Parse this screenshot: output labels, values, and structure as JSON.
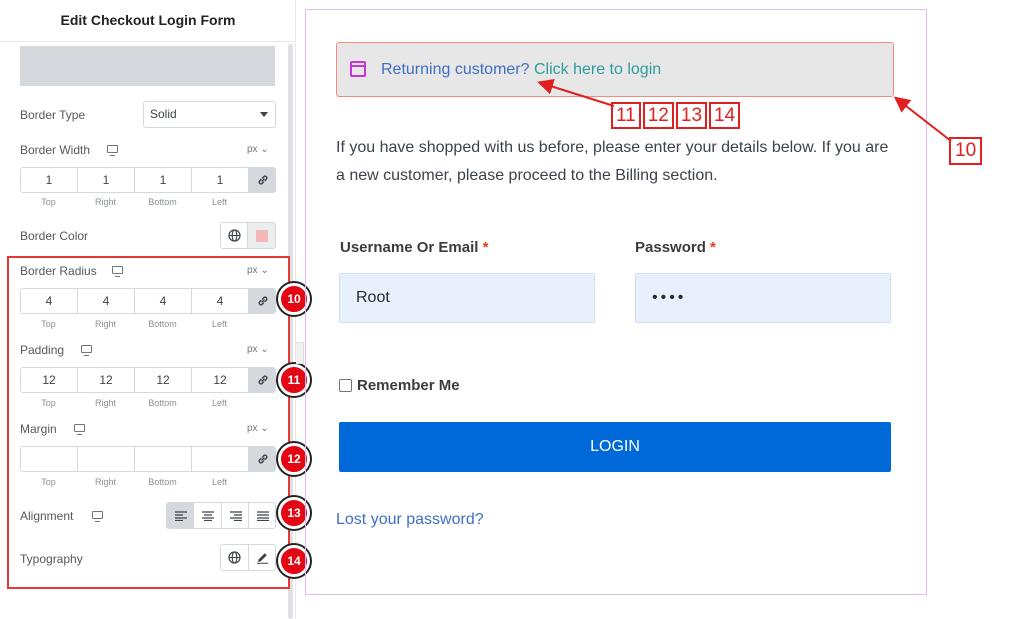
{
  "panel": {
    "title": "Edit Checkout Login Form",
    "border_type": {
      "label": "Border Type",
      "value": "Solid"
    },
    "border_width": {
      "label": "Border Width",
      "unit": "px ⌄",
      "values": [
        "1",
        "1",
        "1",
        "1"
      ]
    },
    "border_color": {
      "label": "Border Color",
      "color": "#f4b8b8"
    },
    "border_radius": {
      "label": "Border Radius",
      "unit": "px ⌄",
      "values": [
        "4",
        "4",
        "4",
        "4"
      ]
    },
    "padding": {
      "label": "Padding",
      "unit": "px ⌄",
      "values": [
        "12",
        "12",
        "12",
        "12"
      ]
    },
    "margin": {
      "label": "Margin",
      "unit": "px ⌄",
      "values": [
        "",
        "",
        "",
        ""
      ]
    },
    "side_labels": [
      "Top",
      "Right",
      "Bottom",
      "Left"
    ],
    "alignment": {
      "label": "Alignment",
      "options": [
        "align-left-icon",
        "align-center-icon",
        "align-right-icon",
        "align-justify-icon"
      ],
      "active": "align-left-icon"
    },
    "typography": {
      "label": "Typography"
    },
    "markers": [
      "10",
      "11",
      "12",
      "13",
      "14"
    ]
  },
  "preview": {
    "notice": {
      "text": "Returning customer?",
      "link": "Click here to login"
    },
    "annotations": [
      "11",
      "12",
      "13",
      "14"
    ],
    "annotation_10": "10",
    "intro": "If you have shopped with us before, please enter your details below. If you are a new customer, please proceed to the Billing section.",
    "username": {
      "label": "Username Or Email",
      "required": "*",
      "value": "Root"
    },
    "password": {
      "label": "Password",
      "required": "*",
      "value": "••••"
    },
    "remember": "Remember Me",
    "login_button": "LOGIN",
    "lost_password": "Lost your password?"
  },
  "colors": {
    "accent": "#0069d9",
    "annotation_red": "#e02020",
    "marker_red": "#e30613",
    "notice_link": "#2f9d9a"
  }
}
